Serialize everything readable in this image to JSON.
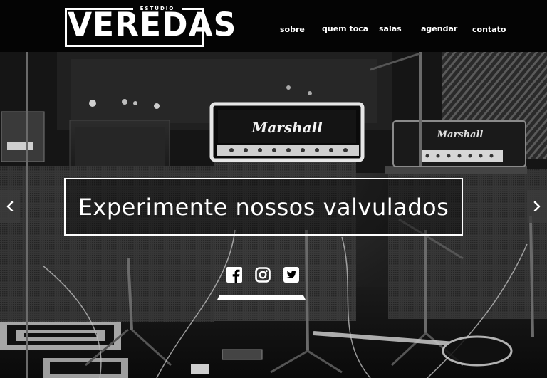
{
  "header": {
    "logo": {
      "tagline": "ESTÚDIO",
      "wordmark": "VEREDAS"
    },
    "nav": [
      {
        "label": "sobre"
      },
      {
        "label": "quem toca"
      },
      {
        "label": "salas"
      },
      {
        "label": "agendar"
      },
      {
        "label": "contato"
      }
    ]
  },
  "hero": {
    "caption": "Experimente nossos valvulados",
    "amp_brand_center": "Marshall",
    "amp_brand_right": "Marshall",
    "social": [
      {
        "name": "facebook",
        "icon": "facebook-icon"
      },
      {
        "name": "instagram",
        "icon": "instagram-icon"
      },
      {
        "name": "twitter",
        "icon": "twitter-icon"
      }
    ],
    "arrows": {
      "prev": "chevron-left-icon",
      "next": "chevron-right-icon"
    }
  },
  "colors": {
    "background": "#040404",
    "text": "#ffffff"
  }
}
